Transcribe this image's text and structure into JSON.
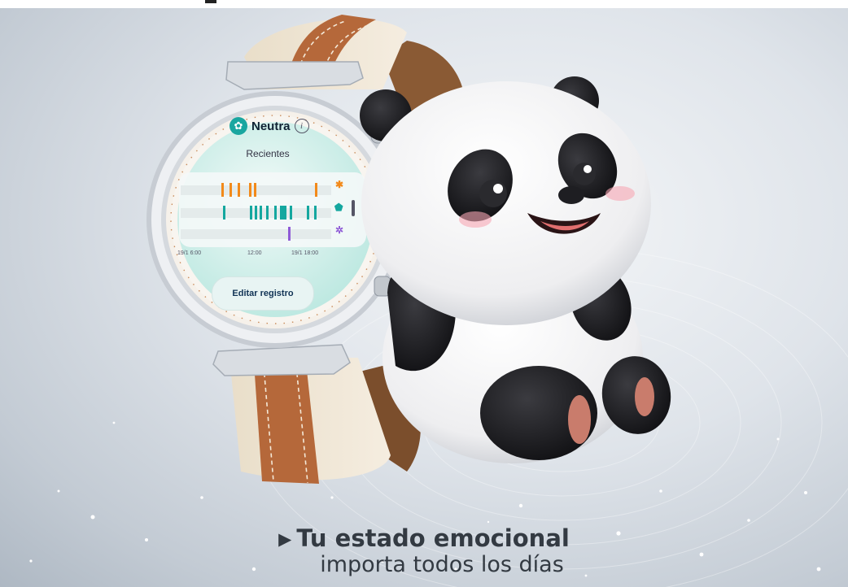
{
  "watch_screen": {
    "mood_icon": "flower-icon",
    "mood": "Neutra",
    "info_icon": "info-icon",
    "section_title": "Recientes",
    "legend_icons": [
      {
        "name": "orange-flower-icon",
        "glyph": "✱",
        "color": "#f28a1a"
      },
      {
        "name": "teal-flower-icon",
        "glyph": "⬟",
        "color": "#14a79f"
      },
      {
        "name": "purple-flower-icon",
        "glyph": "✲",
        "color": "#8e5ad6"
      }
    ],
    "time_axis": [
      "19/1 6:00",
      "12:00",
      "19/1 18:00"
    ],
    "edit_button": "Editar registro"
  },
  "caption": {
    "arrow_icon": "play-arrow-icon",
    "line1": "Tu estado emocional",
    "line2": "importa todos los días"
  }
}
